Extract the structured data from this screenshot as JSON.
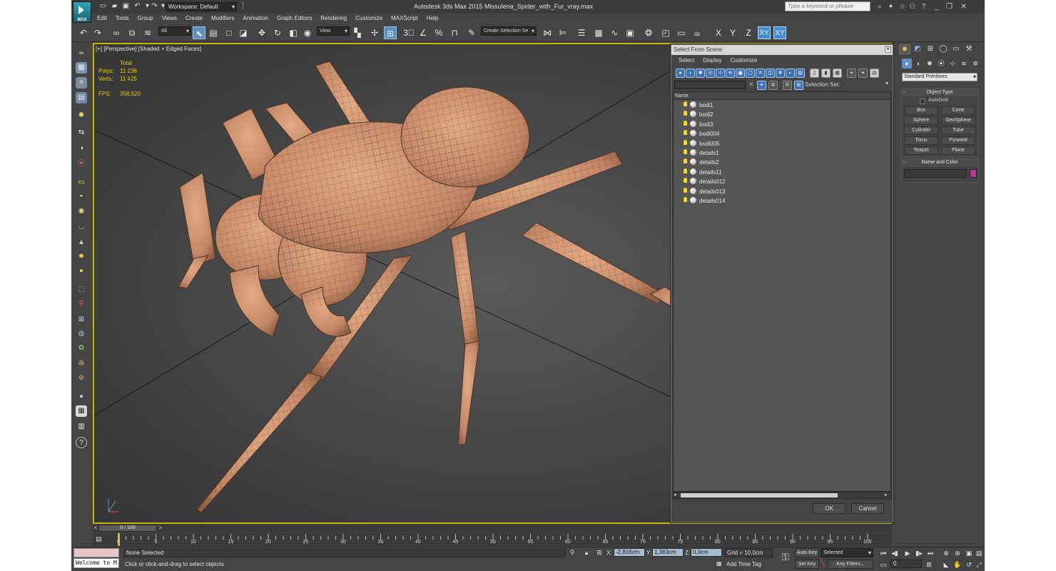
{
  "titlebar": {
    "logo": "MAX",
    "workspace": "Workspace: Default",
    "title": "Autodesk 3ds Max  2015     Missulena_Spider_with_Fur_vray.max",
    "search_placeholder": "Type a keyword or phrase"
  },
  "menu": [
    "Edit",
    "Tools",
    "Group",
    "Views",
    "Create",
    "Modifiers",
    "Animation",
    "Graph Editors",
    "Rendering",
    "Customize",
    "MAXScript",
    "Help"
  ],
  "toolbar": {
    "selection_filter": "All",
    "reference_coord": "View",
    "named_selection": "Create Selection Se",
    "axis_x": "X",
    "axis_y": "Y",
    "axis_z": "Z",
    "axis_xy": "XY",
    "axis_xy2": "XY"
  },
  "viewport": {
    "label": "[+] [Perspective] [Shaded + Edged Faces]",
    "stats_header": "Total",
    "polys_label": "Polys:",
    "polys_value": "11 238",
    "verts_label": "Verts:",
    "verts_value": "11 425",
    "fps_label": "FPS:",
    "fps_value": "358,520"
  },
  "select_from_scene": {
    "title": "Select From Scene",
    "menu": [
      "Select",
      "Display",
      "Customize"
    ],
    "selection_set_label": "Selection Set:",
    "column_name": "Name",
    "items": [
      "bodi1",
      "bodi2",
      "bodi3",
      "bodi004",
      "bodi005",
      "details1",
      "details2",
      "details11",
      "details012",
      "details013",
      "details014"
    ],
    "ok": "OK",
    "cancel": "Cancel"
  },
  "command_panel": {
    "category": "Standard Primitives",
    "object_type_header": "Object Type",
    "autogrid": "AutoGrid",
    "primitives": [
      "Box",
      "Cone",
      "Sphere",
      "GeoSphere",
      "Cylinder",
      "Tube",
      "Torus",
      "Pyramid",
      "Teapot",
      "Plane"
    ],
    "name_color_header": "Name and Color",
    "color": "#b23893"
  },
  "timeline": {
    "frame_display": "0 / 100",
    "ticks": [
      "0",
      "5",
      "10",
      "15",
      "20",
      "25",
      "30",
      "35",
      "40",
      "45",
      "50",
      "55",
      "60",
      "65",
      "70",
      "75",
      "80",
      "85",
      "90",
      "95",
      "100"
    ]
  },
  "status": {
    "listener": "Welcome to M",
    "selection": "None Selected",
    "prompt": "Click or click-and-drag to select objects",
    "x_label": "X:",
    "x_value": "-2,816cm",
    "y_label": "Y:",
    "y_value": "1,363cm",
    "z_label": "Z:",
    "z_value": "0,0cm",
    "grid": "Grid = 10,0cm",
    "add_time_tag": "Add Time Tag",
    "auto_key": "Auto Key",
    "set_key": "Set Key",
    "selected": "Selected",
    "key_filters": "Key Filters...",
    "current_frame": "0"
  },
  "colors": {
    "viewport_border": "#c8b400",
    "spider_skin": "#c98f6a",
    "stats": "#e4d200",
    "active_axis": "#3f8ed6"
  }
}
